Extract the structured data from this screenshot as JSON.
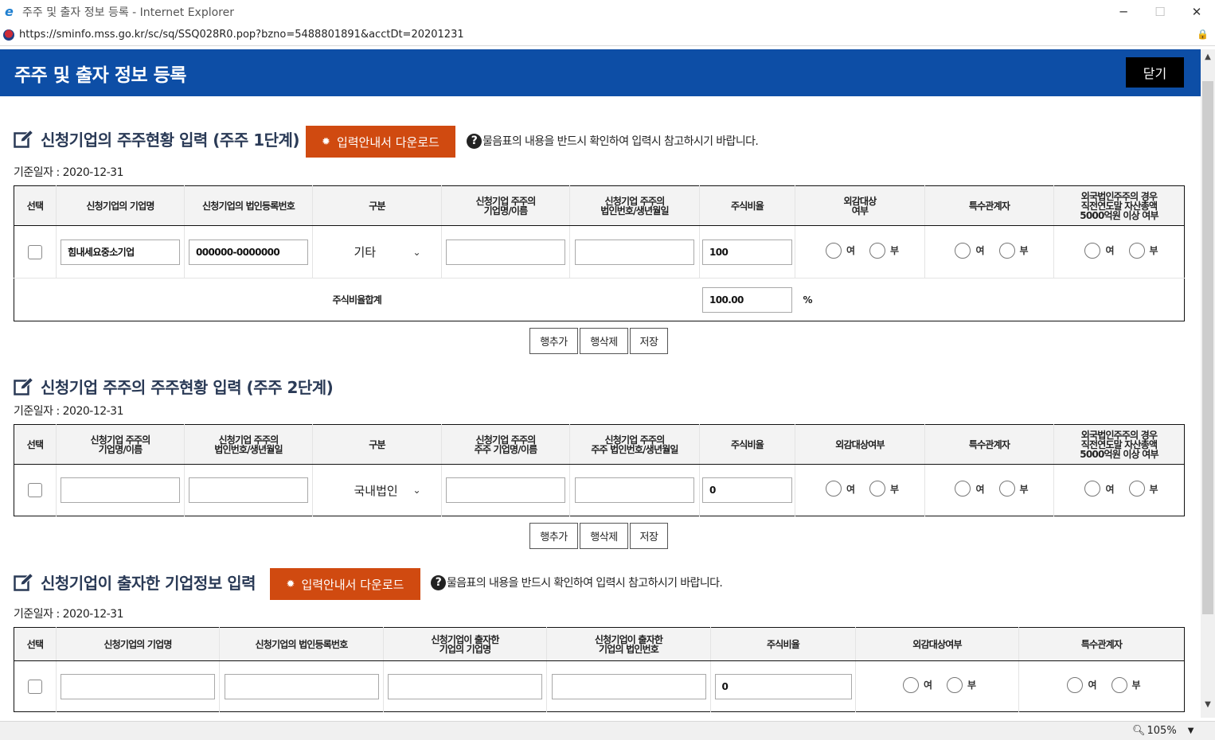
{
  "window": {
    "title": "주주 및 출자 정보 등록 - Internet Explorer",
    "url": "https://sminfo.mss.go.kr/sc/sq/SSQ028R0.pop?bzno=5488801891&acctDt=20201231",
    "zoom": "105%"
  },
  "header": {
    "title": "주주 및 출자 정보 등록",
    "close_label": "닫기"
  },
  "common": {
    "download_label": "입력안내서 다운로드",
    "help_text": "물음표의 내용을 반드시 확인하여 입력시 참고하시기 바랍니다.",
    "ref_date": "기준일자 : 2020-12-31",
    "yes": "여",
    "no": "부",
    "add_row": "행추가",
    "del_row": "행삭제",
    "save": "저장"
  },
  "section1": {
    "title": "신청기업의 주주현황 입력 (주주 1단계)",
    "headers": [
      "선택",
      "신청기업의 기업명",
      "신청기업의 법인등록번호",
      "구분",
      "신청기업 주주의\n기업명/이름",
      "신청기업 주주의\n법인번호/생년월일",
      "주식비율",
      "외감대상\n여부",
      "특수관계자",
      "외국법인주주의 경우\n직전연도말 자산총액\n5000억원 이상 여부"
    ],
    "row": {
      "company": "힘내세요중소기업",
      "reg_no": "000000-0000000",
      "type": "기타",
      "holder_name": "",
      "holder_no": "",
      "ratio": "100"
    },
    "total_label": "주식비율합계",
    "total_value": "100.00",
    "percent": "%"
  },
  "section2": {
    "title": "신청기업 주주의 주주현황 입력 (주주 2단계)",
    "headers": [
      "선택",
      "신청기업 주주의\n기업명/이름",
      "신청기업 주주의\n법인번호/생년월일",
      "구분",
      "신청기업 주주의\n주주 기업명/이름",
      "신청기업 주주의\n주주 법인번호/생년월일",
      "주식비율",
      "외감대상여부",
      "특수관계자",
      "외국법인주주의 경우\n직전연도말 자산총액\n5000억원 이상 여부"
    ],
    "row": {
      "holder_name": "",
      "holder_no": "",
      "type": "국내법인",
      "sub_name": "",
      "sub_no": "",
      "ratio": "0"
    }
  },
  "section3": {
    "title": "신청기업이 출자한 기업정보 입력",
    "headers": [
      "선택",
      "신청기업의 기업명",
      "신청기업의 법인등록번호",
      "신청기업이 출자한\n기업의 기업명",
      "신청기업이 출자한\n기업의 법인번호",
      "주식비율",
      "외감대상여부",
      "특수관계자"
    ],
    "row": {
      "company": "",
      "reg_no": "",
      "invest_name": "",
      "invest_no": "",
      "ratio": "0"
    }
  },
  "colors": {
    "header_bg": "#0d4ea6",
    "download_btn": "#d04a10",
    "close_btn": "#000000"
  }
}
